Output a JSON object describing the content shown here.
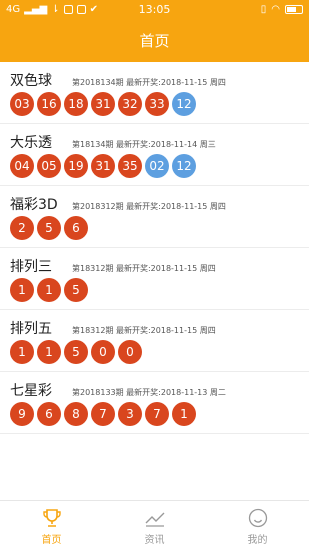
{
  "statusbar": {
    "network": "4G",
    "time": "13:05"
  },
  "appbar": {
    "title": "首页"
  },
  "lotteries": [
    {
      "name": "双色球",
      "meta": "第2018134期 最新开奖:2018-11-15 周四",
      "red": [
        "03",
        "16",
        "18",
        "31",
        "32",
        "33"
      ],
      "blue": [
        "12"
      ]
    },
    {
      "name": "大乐透",
      "meta": "第18134期 最新开奖:2018-11-14 周三",
      "red": [
        "04",
        "05",
        "19",
        "31",
        "35"
      ],
      "blue": [
        "02",
        "12"
      ]
    },
    {
      "name": "福彩3D",
      "meta": "第2018312期 最新开奖:2018-11-15 周四",
      "red": [
        "2",
        "5",
        "6"
      ],
      "blue": []
    },
    {
      "name": "排列三",
      "meta": "第18312期 最新开奖:2018-11-15 周四",
      "red": [
        "1",
        "1",
        "5"
      ],
      "blue": []
    },
    {
      "name": "排列五",
      "meta": "第18312期 最新开奖:2018-11-15 周四",
      "red": [
        "1",
        "1",
        "5",
        "0",
        "0"
      ],
      "blue": []
    },
    {
      "name": "七星彩",
      "meta": "第2018133期 最新开奖:2018-11-13 周二",
      "red": [
        "9",
        "6",
        "8",
        "7",
        "3",
        "7",
        "1"
      ],
      "blue": []
    }
  ],
  "tabbar": {
    "tabs": [
      {
        "label": "首页",
        "icon": "trophy-icon"
      },
      {
        "label": "资讯",
        "icon": "trend-icon"
      },
      {
        "label": "我的",
        "icon": "smile-icon"
      }
    ],
    "active_color": "#f7a510"
  },
  "colors": {
    "brand": "#f7a510",
    "red_ball": "#d9461e",
    "blue_ball": "#5d9fe0"
  }
}
